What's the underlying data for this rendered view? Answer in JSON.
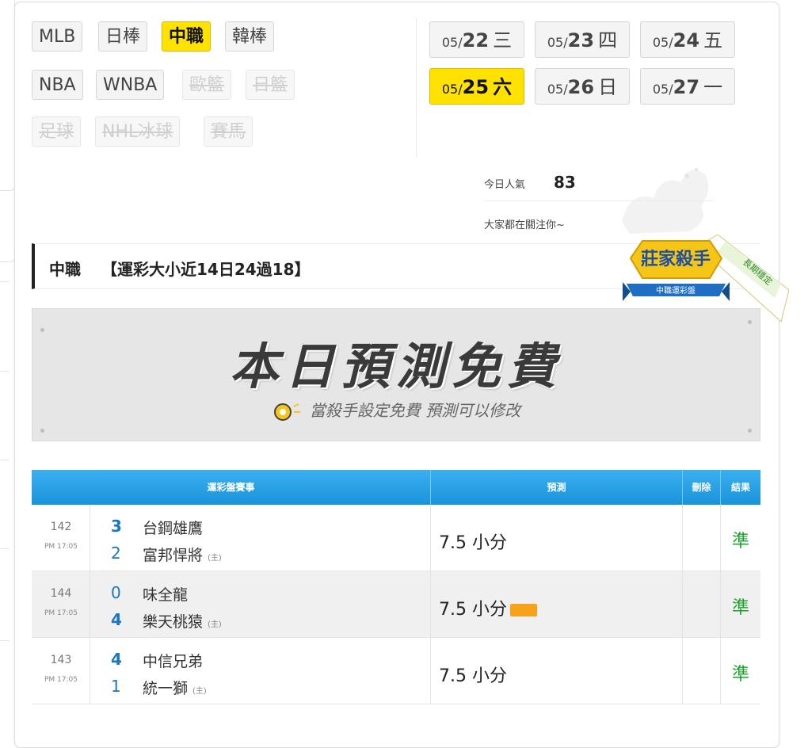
{
  "leagues": [
    {
      "label": "MLB",
      "state": "normal"
    },
    {
      "label": "日棒",
      "state": "normal"
    },
    {
      "label": "中職",
      "state": "active"
    },
    {
      "label": "韓棒",
      "state": "normal"
    },
    {
      "label": "NBA",
      "state": "normal"
    },
    {
      "label": "WNBA",
      "state": "normal"
    },
    {
      "label": "歐籃",
      "state": "disabled"
    },
    {
      "label": "日籃",
      "state": "disabled"
    },
    {
      "label": "足球",
      "state": "disabled"
    },
    {
      "label": "NHL冰球",
      "state": "disabled"
    },
    {
      "label": "賽馬",
      "state": "disabled"
    }
  ],
  "dates": [
    {
      "md": "05/",
      "day": "22",
      "wd": "三",
      "active": false
    },
    {
      "md": "05/",
      "day": "23",
      "wd": "四",
      "active": false
    },
    {
      "md": "05/",
      "day": "24",
      "wd": "五",
      "active": false
    },
    {
      "md": "05/",
      "day": "25",
      "wd": "六",
      "active": true
    },
    {
      "md": "05/",
      "day": "26",
      "wd": "日",
      "active": false
    },
    {
      "md": "05/",
      "day": "27",
      "wd": "一",
      "active": false
    }
  ],
  "popularity": {
    "label": "今日人氣",
    "count": "83",
    "watch": "大家都在關注你~"
  },
  "title": {
    "league": "中職",
    "record": "【運彩大小近14日24過18】"
  },
  "badge": {
    "main": "莊家殺手",
    "sub": "中職運彩盤",
    "ribbon": "長期穩定"
  },
  "banner": {
    "headline": "本日預測免費",
    "subtitle": "當殺手設定免費 預測可以修改"
  },
  "table": {
    "headers": {
      "game": "運彩盤賽事",
      "prediction": "預測",
      "delete": "刪除",
      "result": "結果"
    },
    "rows": [
      {
        "no": "142",
        "time": "PM 17:05",
        "away_score": "3",
        "away": "台鋼雄鷹",
        "home_score": "2",
        "home": "富邦悍將",
        "home_mark": "(主)",
        "prediction": "7.5 小分",
        "tag": false,
        "result": "準"
      },
      {
        "no": "144",
        "time": "PM 17:05",
        "away_score": "0",
        "away": "味全龍",
        "home_score": "4",
        "home": "樂天桃猿",
        "home_mark": "(主)",
        "prediction": "7.5 小分",
        "tag": true,
        "result": "準"
      },
      {
        "no": "143",
        "time": "PM 17:05",
        "away_score": "4",
        "away": "中信兄弟",
        "home_score": "1",
        "home": "統一獅",
        "home_mark": "(主)",
        "prediction": "7.5 小分",
        "tag": false,
        "result": "準"
      }
    ]
  }
}
